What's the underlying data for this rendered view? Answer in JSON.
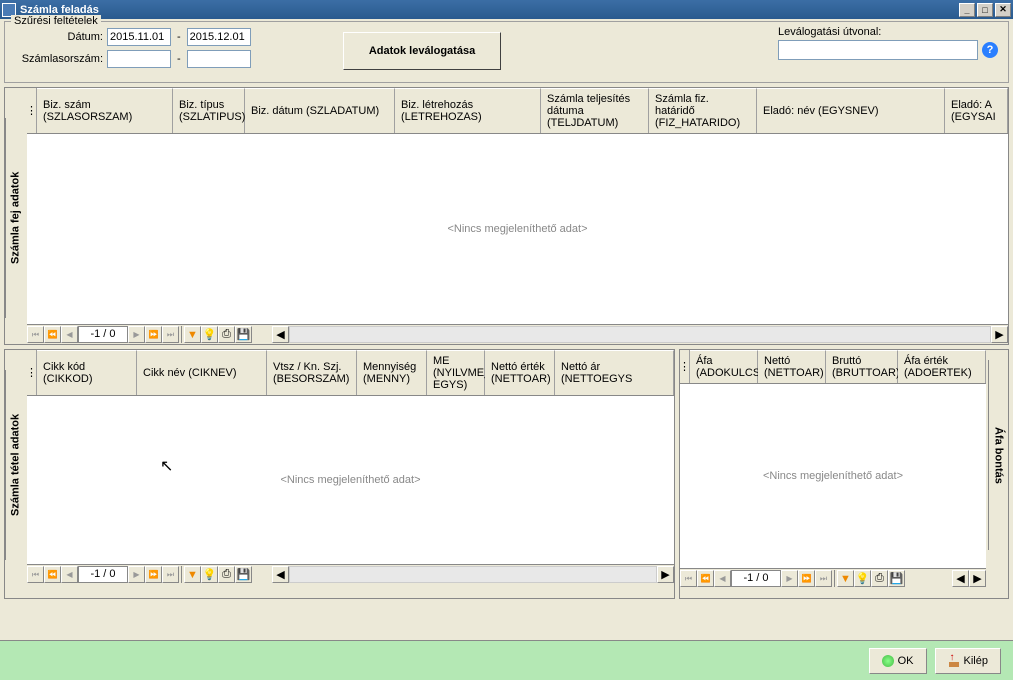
{
  "titlebar": {
    "title": "Számla feladás"
  },
  "filter": {
    "legend": "Szűrési feltételek",
    "date_label": "Dátum:",
    "date_from": "2015.11.01",
    "date_to": "2015.12.01",
    "invno_label": "Számlasorszám:",
    "invno_from": "",
    "invno_to": "",
    "dash": "-",
    "fetch_button": "Adatok leválogatása",
    "path_label": "Leválogatási útvonal:",
    "path_value": "",
    "help": "?"
  },
  "grid1": {
    "title": "Számla fej adatok",
    "columns": [
      "Biz. szám (SZLASORSZAM)",
      "Biz. típus (SZLATIPUS)",
      "Biz. dátum (SZLADATUM)",
      "Biz. létrehozás (LETREHOZAS)",
      "Számla teljesítés dátuma (TELJDATUM)",
      "Számla fiz. határidő (FIZ_HATARIDO)",
      "Eladó: név (EGYSNEV)",
      "Eladó: A (EGYSAI"
    ],
    "empty": "<Nincs megjeleníthető adat>",
    "counter": "-1 / 0"
  },
  "grid2": {
    "title": "Számla tétel adatok",
    "columns": [
      "Cikk kód (CIKKOD)",
      "Cikk név (CIKNEV)",
      "Vtsz / Kn. Szj. (BESORSZAM)",
      "Mennyiség (MENNY)",
      "ME (NYILVME_MERTEK EGYS)",
      "Nettó érték (NETTOAR)",
      "Nettó ár (NETTOEGYS"
    ],
    "empty": "<Nincs megjeleníthető adat>",
    "counter": "-1 / 0"
  },
  "grid3": {
    "title": "Áfa bontás",
    "columns": [
      "Áfa (ADOKULCS)",
      "Nettó (NETTOAR)",
      "Bruttó (BRUTTOAR)",
      "Áfa érték (ADOERTEK)"
    ],
    "empty": "<Nincs megjeleníthető adat>",
    "counter": "-1 / 0"
  },
  "nav": {
    "first": "⏮",
    "prevpg": "⏪",
    "prev": "◀",
    "next": "▶",
    "nextpg": "⏩",
    "last": "⏭",
    "filter": "▼",
    "bulb": "💡",
    "print": "⎙",
    "save": "💾",
    "scroll_left": "◀",
    "scroll_right": "▶"
  },
  "footer": {
    "ok": "OK",
    "exit": "Kilép"
  }
}
